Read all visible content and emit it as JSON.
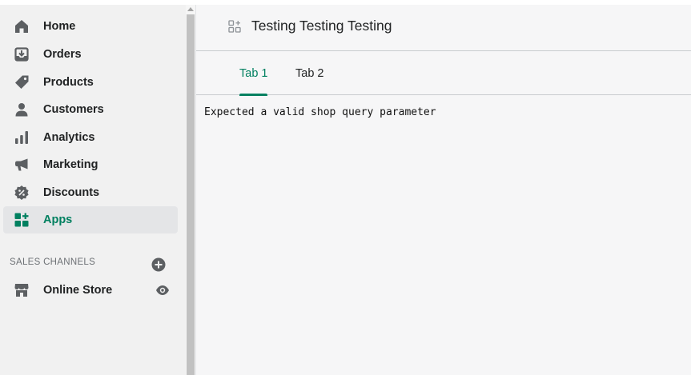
{
  "sidebar": {
    "items": [
      {
        "label": "Home",
        "icon": "home-icon"
      },
      {
        "label": "Orders",
        "icon": "orders-icon"
      },
      {
        "label": "Products",
        "icon": "tag-icon"
      },
      {
        "label": "Customers",
        "icon": "person-icon"
      },
      {
        "label": "Analytics",
        "icon": "bar-chart-icon"
      },
      {
        "label": "Marketing",
        "icon": "megaphone-icon"
      },
      {
        "label": "Discounts",
        "icon": "discount-icon"
      },
      {
        "label": "Apps",
        "icon": "apps-icon",
        "active": true
      }
    ],
    "sales_channels": {
      "title": "SALES CHANNELS",
      "items": [
        {
          "label": "Online Store",
          "icon": "store-icon"
        }
      ]
    }
  },
  "header": {
    "title": "Testing Testing Testing"
  },
  "tabs": [
    {
      "label": "Tab 1",
      "active": true
    },
    {
      "label": "Tab 2",
      "active": false
    }
  ],
  "main": {
    "message": "Expected a valid shop query parameter"
  },
  "colors": {
    "accent": "#008060",
    "text": "#202223",
    "icon": "#5c5f62"
  }
}
